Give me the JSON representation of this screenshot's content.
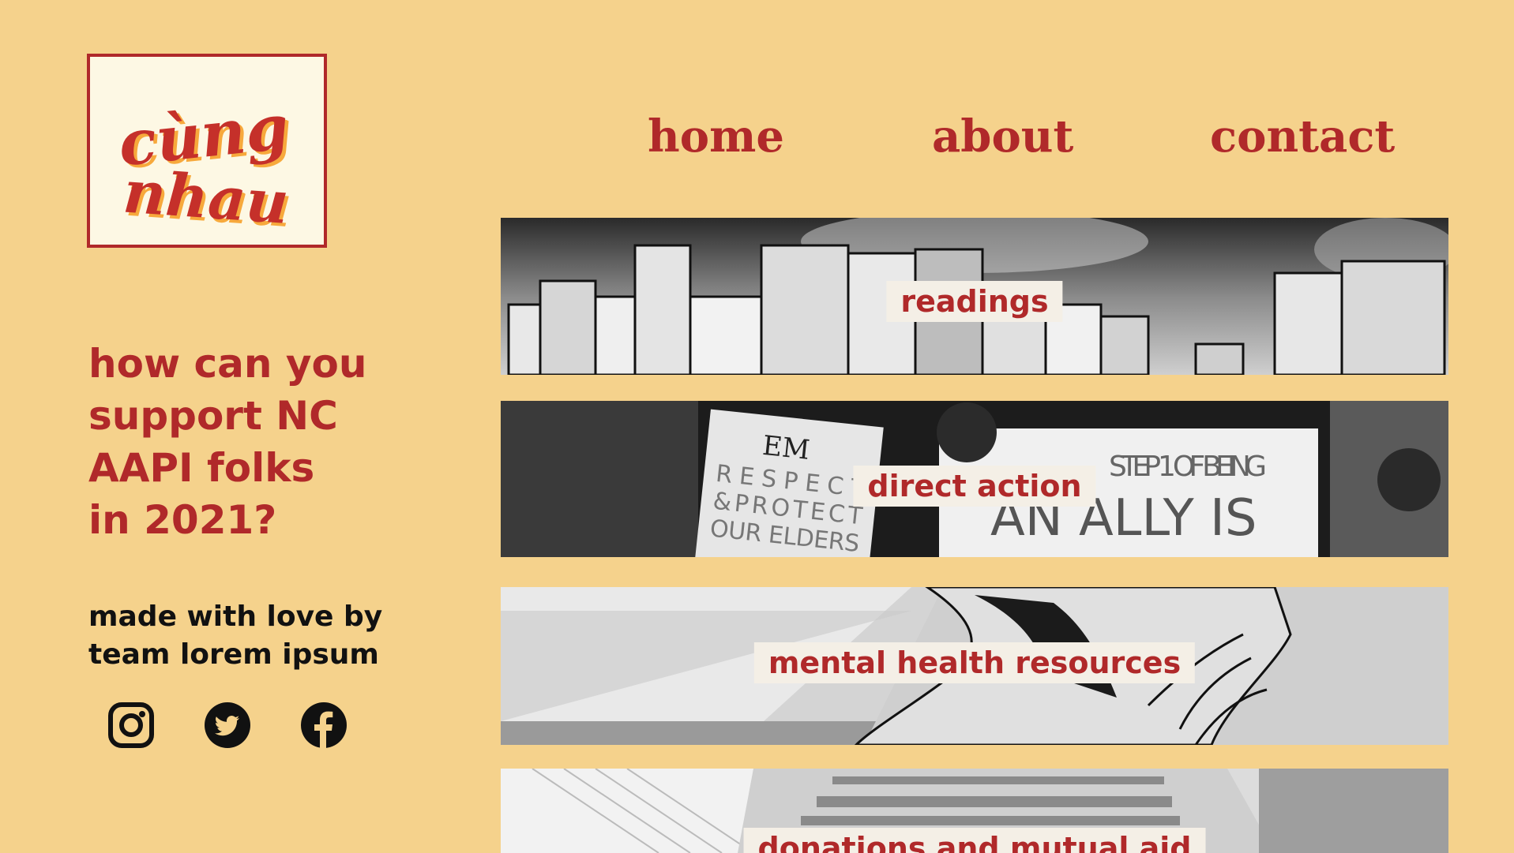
{
  "logo": {
    "line1": "cùng",
    "line2": "nhau"
  },
  "nav": {
    "home": "home",
    "about": "about",
    "contact": "contact"
  },
  "hero": {
    "lines": [
      "how can you",
      "support NC",
      "AAPI folks",
      "in 2021?"
    ]
  },
  "credits": {
    "line1": "made with love by",
    "line2": "team lorem ipsum"
  },
  "social": [
    "instagram-icon",
    "twitter-icon",
    "facebook-icon"
  ],
  "banners": [
    {
      "label": "readings"
    },
    {
      "label": "direct action",
      "sign_left": "RESPECT &PROTECT OUR ELDERS",
      "sign_left_top": "EM",
      "sign_right_1": "STEP 1 OF BEING",
      "sign_right_2": "AN ALLY IS"
    },
    {
      "label": "mental health resources"
    },
    {
      "label": "donations and mutual aid"
    }
  ],
  "colors": {
    "background": "#f5d28c",
    "accent": "#b0292a",
    "logo_bg": "#fdf8e4",
    "label_bg": "#f4efe6"
  }
}
